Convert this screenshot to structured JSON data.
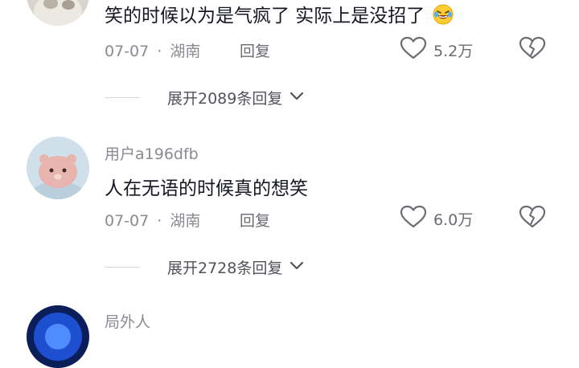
{
  "comments": [
    {
      "username": "",
      "text": "笑的时候以为是气疯了 实际上是没招了",
      "emoji_icon": "rolling-laughing-emoji",
      "date": "07-07",
      "location": "湖南",
      "reply_label": "回复",
      "likes": "5.2万",
      "expand_label": "展开2089条回复"
    },
    {
      "username": "用户a196dfb",
      "text": "人在无语的时候真的想笑",
      "date": "07-07",
      "location": "湖南",
      "reply_label": "回复",
      "likes": "6.0万",
      "expand_label": "展开2728条回复"
    },
    {
      "username": "局外人"
    }
  ],
  "separator": "·",
  "colors": {
    "secondary_text": "#8a8b91",
    "primary_text": "#161823",
    "icon_stroke": "#6b6c72"
  }
}
